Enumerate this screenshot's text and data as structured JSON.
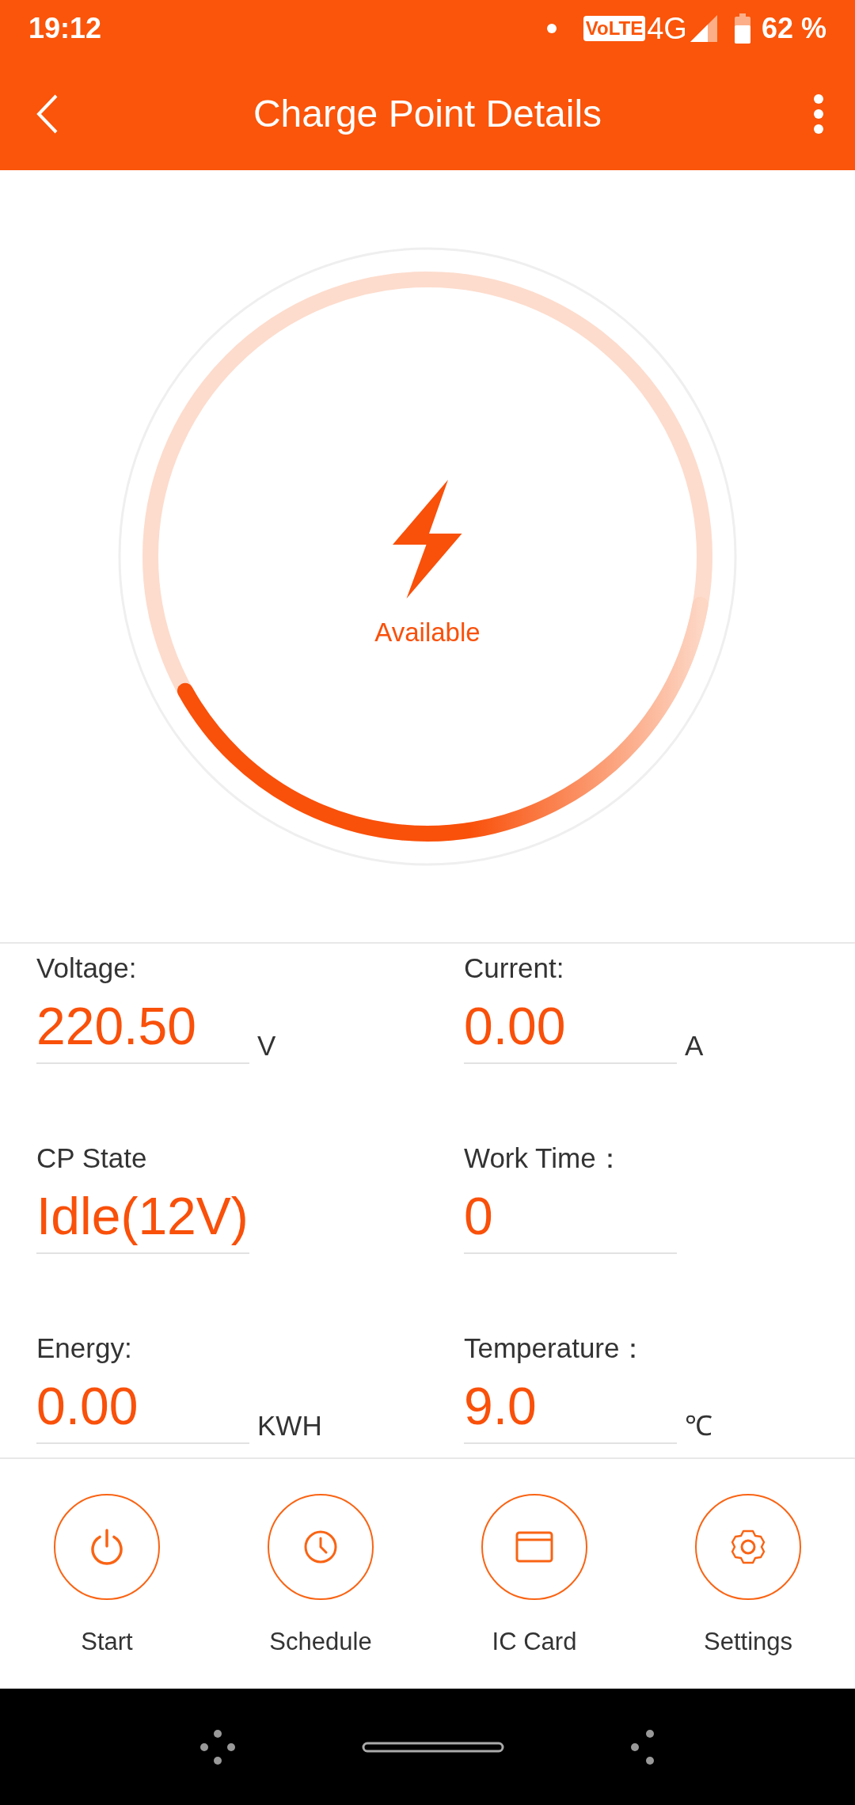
{
  "status_bar": {
    "time": "19:12",
    "volte": "VoLTE",
    "network": "4G",
    "battery": "62 %"
  },
  "app_bar": {
    "title": "Charge Point Details"
  },
  "gauge": {
    "status": "Available"
  },
  "readings": [
    {
      "label": "Voltage:",
      "value": "220.50",
      "unit": "V"
    },
    {
      "label": "Current:",
      "value": "0.00",
      "unit": "A"
    },
    {
      "label": "CP State",
      "value": "Idle(12V)"
    },
    {
      "label": "Work Time：",
      "value": "0"
    },
    {
      "label": "Energy:",
      "value": "0.00",
      "unit": "KWH"
    },
    {
      "label": "Temperature：",
      "value": "9.0",
      "unit": "℃"
    }
  ],
  "actions": [
    {
      "kind": "power",
      "label": "Start"
    },
    {
      "kind": "clock",
      "label": "Schedule"
    },
    {
      "kind": "card",
      "label": "IC Card"
    },
    {
      "kind": "gear",
      "label": "Settings"
    }
  ]
}
